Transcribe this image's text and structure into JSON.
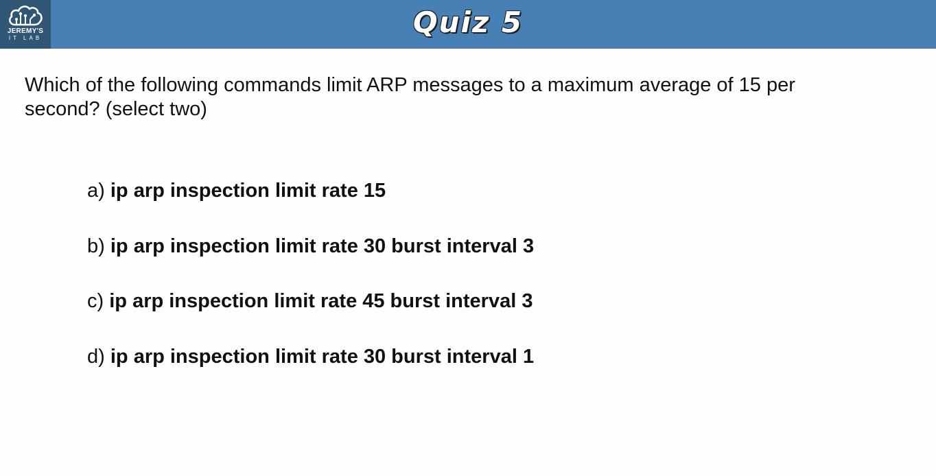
{
  "header": {
    "title": "Quiz 5",
    "background_color": "#4680b4",
    "logo": {
      "icon": "cloud-circuit-icon",
      "line1": "JEREMY'S",
      "line2": "IT LAB",
      "background_color": "#2f5675"
    }
  },
  "question": {
    "text": "Which of the following commands limit ARP messages to a maximum average of 15 per second? (select two)"
  },
  "answers": [
    {
      "letter": "a)",
      "command": "ip arp inspection limit rate 15"
    },
    {
      "letter": "b)",
      "command": "ip arp inspection limit rate 30 burst interval 3"
    },
    {
      "letter": "c)",
      "command": "ip arp inspection limit rate 45 burst interval 3"
    },
    {
      "letter": "d)",
      "command": "ip arp inspection limit rate 30 burst interval 1"
    }
  ]
}
